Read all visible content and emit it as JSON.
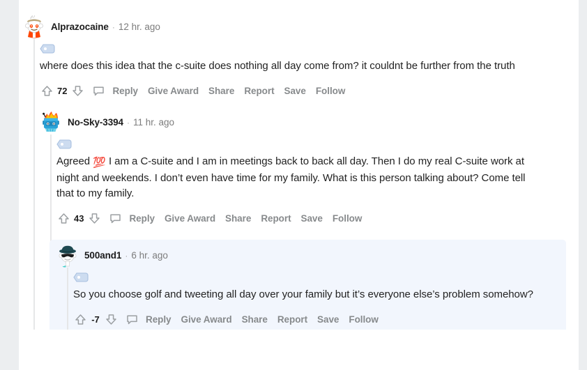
{
  "theme": {
    "page_background": "#eceef0",
    "sheet_background": "#ffffff",
    "highlight_background": "#f2f6fd",
    "threadline_color": "#e6e7e8",
    "username_color": "#1c1c1c",
    "timestamp_color": "#7c7c7c",
    "body_text_color": "#222222",
    "action_text_color": "#878a8c",
    "collapse_tag_color": "#a8c0e0"
  },
  "separator": "·",
  "action_labels": {
    "reply": "Reply",
    "give_award": "Give Award",
    "share": "Share",
    "report": "Report",
    "save": "Save",
    "follow": "Follow"
  },
  "icons": {
    "upvote": "upvote-arrow-icon",
    "downvote": "downvote-arrow-icon",
    "comment_bubble": "comment-bubble-icon",
    "collapse": "collapse-thread-icon"
  },
  "comments": [
    {
      "id": "comment-1",
      "username": "Alprazocaine",
      "timestamp": "12 hr. ago",
      "score": "72",
      "text": "where does this idea that the c-suite does nothing all day come from? it couldnt be further from the truth",
      "avatar": "snoo-tan-cap-orange-avatar",
      "highlighted": false,
      "depth": 0
    },
    {
      "id": "comment-2",
      "username": "No-Sky-3394",
      "timestamp": "11 hr. ago",
      "score": "43",
      "text_before_emoji": "Agreed ",
      "emoji": "💯",
      "text_after_emoji": " I am a C-suite and I am in meetings back to back all day. Then I do my real C-suite work at night and weekends. I don’t even have time for my family. What is this person talking about? Come tell that to my family.",
      "avatar": "robot-flame-hair-avatar",
      "highlighted": false,
      "depth": 1
    },
    {
      "id": "comment-3",
      "username": "500and1",
      "timestamp": "6 hr. ago",
      "score": "-7",
      "text": "So you choose golf and tweeting all day over your family but it’s everyone else’s problem somehow?",
      "avatar": "snoo-fedora-sunglasses-avatar",
      "highlighted": true,
      "depth": 2
    }
  ]
}
